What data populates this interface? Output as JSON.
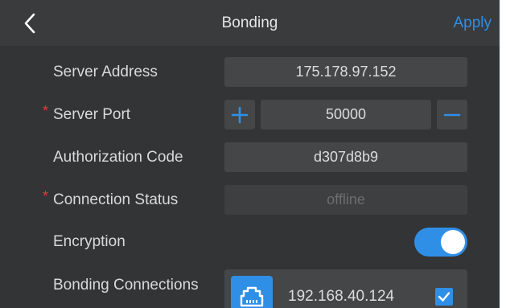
{
  "header": {
    "title": "Bonding",
    "apply_label": "Apply",
    "back_icon": "chevron-left-icon"
  },
  "server_address": {
    "label": "Server Address",
    "value": "175.178.97.152"
  },
  "server_port": {
    "label": "Server Port",
    "required_marker": "*",
    "value": "50000",
    "increment_icon": "plus-icon",
    "decrement_icon": "minus-icon"
  },
  "authorization_code": {
    "label": "Authorization Code",
    "value": "d307d8b9"
  },
  "connection_status": {
    "label": "Connection Status",
    "required_marker": "*",
    "value": "offline"
  },
  "encryption": {
    "label": "Encryption",
    "enabled": true
  },
  "bonding_connections": {
    "label": "Bonding Connections",
    "items": [
      {
        "icon": "ethernet-port-icon",
        "ip": "192.168.40.124",
        "checked": true
      }
    ]
  },
  "colors": {
    "accent": "#2f8fe6",
    "background": "#333436",
    "field": "#454648",
    "required": "#e23b3b"
  }
}
